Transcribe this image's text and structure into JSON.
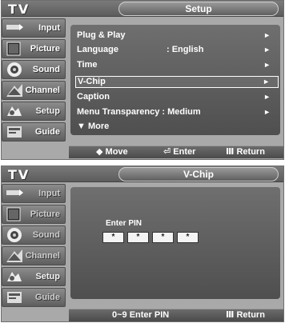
{
  "screens": [
    {
      "tv_label": "TV",
      "title": "Setup",
      "sidebar": [
        {
          "label": "Input",
          "icon": "input-icon"
        },
        {
          "label": "Picture",
          "icon": "picture-icon"
        },
        {
          "label": "Sound",
          "icon": "sound-icon"
        },
        {
          "label": "Channel",
          "icon": "channel-icon"
        },
        {
          "label": "Setup",
          "icon": "setup-icon"
        },
        {
          "label": "Guide",
          "icon": "guide-icon"
        }
      ],
      "menu": [
        {
          "label": "Plug & Play",
          "value": "",
          "arrow": "►"
        },
        {
          "label": "Language",
          "value": ": English",
          "arrow": "►"
        },
        {
          "label": "Time",
          "value": "",
          "arrow": "►"
        },
        {
          "label": "V-Chip",
          "value": "",
          "arrow": "►",
          "selected": true
        },
        {
          "label": "Caption",
          "value": "",
          "arrow": "►"
        },
        {
          "label": "Menu Transparency : Medium",
          "value": "",
          "arrow": "►"
        },
        {
          "label": "▼ More",
          "value": "",
          "arrow": ""
        }
      ],
      "bottom": {
        "move": "Move",
        "enter": "Enter",
        "return": "Return"
      }
    },
    {
      "tv_label": "TV",
      "title": "V-Chip",
      "sidebar": [
        {
          "label": "Input",
          "icon": "input-icon"
        },
        {
          "label": "Picture",
          "icon": "picture-icon"
        },
        {
          "label": "Sound",
          "icon": "sound-icon"
        },
        {
          "label": "Channel",
          "icon": "channel-icon"
        },
        {
          "label": "Setup",
          "icon": "setup-icon"
        },
        {
          "label": "Guide",
          "icon": "guide-icon"
        }
      ],
      "pin_label": "Enter PIN",
      "pin": [
        "*",
        "*",
        "*",
        "*"
      ],
      "bottom": {
        "enter_pin": "0~9 Enter PIN",
        "return": "Return"
      }
    }
  ]
}
